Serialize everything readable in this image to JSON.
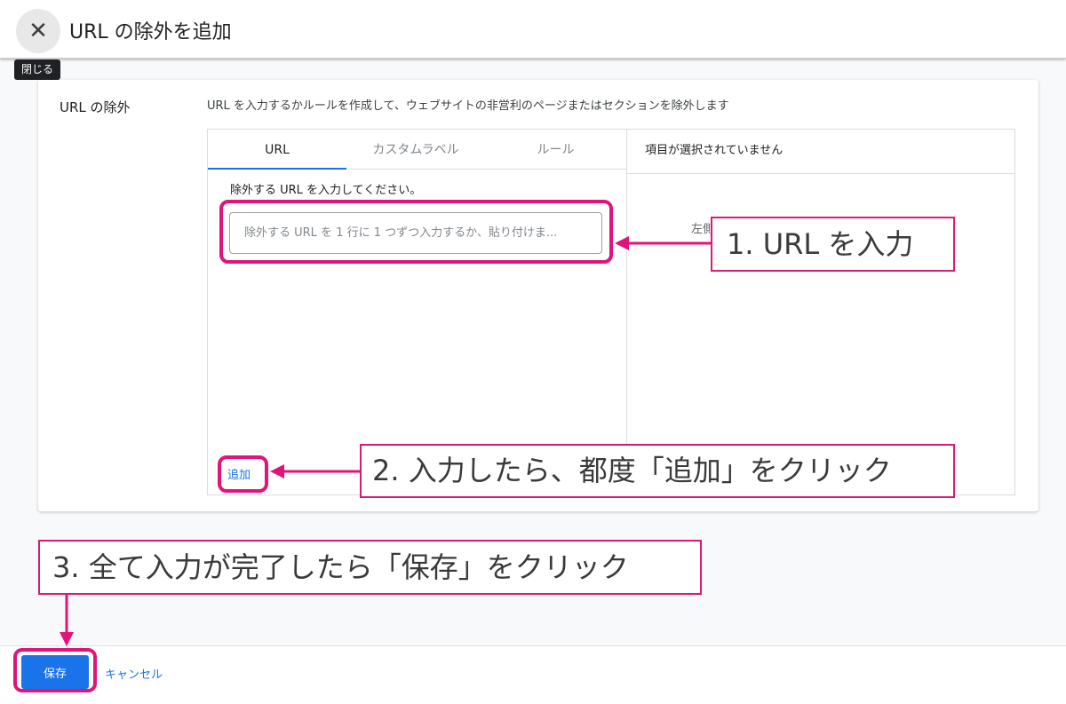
{
  "header": {
    "title": "URL の除外を追加",
    "close_icon": "✕",
    "close_tooltip": "閉じる"
  },
  "section": {
    "label": "URL の除外",
    "description": "URL を入力するかルールを作成して、ウェブサイトの非営利のページまたはセクションを除外します"
  },
  "picker": {
    "tabs": [
      {
        "label": "URL",
        "active": true
      },
      {
        "label": "カスタムラベル",
        "active": false
      },
      {
        "label": "ルール",
        "active": false
      }
    ],
    "prompt": "除外する URL を入力してください。",
    "input_placeholder": "除外する URL を 1 行に 1 つずつ入力するか、貼り付けま...",
    "input_value": "",
    "add_label": "追加",
    "selected_header": "項目が選択されていません",
    "selected_hint": "左側"
  },
  "footer": {
    "save_label": "保存",
    "cancel_label": "キャンセル"
  },
  "annotations": {
    "step1": "1. URL を入力",
    "step2": "2. 入力したら、都度「追加」をクリック",
    "step3": "3. 全て入力が完了したら「保存」をクリック"
  },
  "colors": {
    "accent": "#1a73e8",
    "annotation": "#e0147a"
  }
}
